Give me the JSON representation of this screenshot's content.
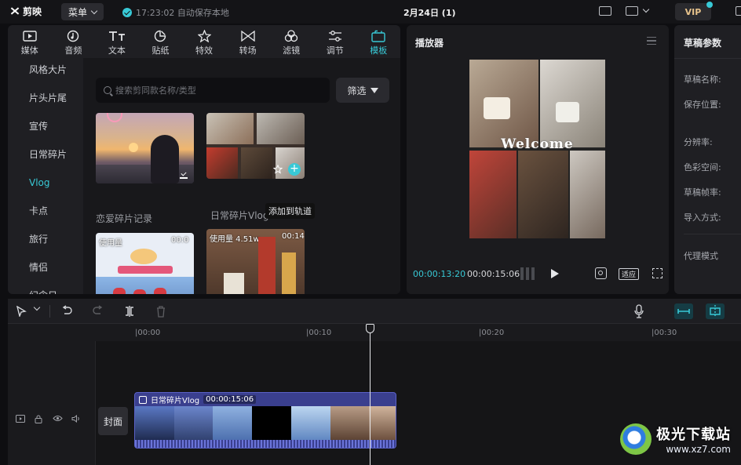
{
  "app": {
    "name": "剪映",
    "menu_label": "菜单",
    "autosave": "17:23:02 自动保存本地",
    "project_title": "2月24日 (1)",
    "vip_label": "VIP"
  },
  "tabs": [
    {
      "label": "媒体",
      "icon": "media-icon"
    },
    {
      "label": "音频",
      "icon": "audio-icon"
    },
    {
      "label": "文本",
      "icon": "text-icon"
    },
    {
      "label": "贴纸",
      "icon": "sticker-icon"
    },
    {
      "label": "特效",
      "icon": "effects-icon"
    },
    {
      "label": "转场",
      "icon": "transition-icon"
    },
    {
      "label": "滤镜",
      "icon": "filter-icon"
    },
    {
      "label": "调节",
      "icon": "adjust-icon"
    },
    {
      "label": "模板",
      "icon": "template-icon"
    }
  ],
  "active_tab": "模板",
  "sidebar": [
    "风格大片",
    "片头片尾",
    "宣传",
    "日常碎片",
    "Vlog",
    "卡点",
    "旅行",
    "情侣",
    "纪念日"
  ],
  "active_sidebar": "Vlog",
  "search": {
    "placeholder": "搜索剪同款名称/类型"
  },
  "filter_label": "筛选",
  "templates": [
    {
      "label": "恋爱碎片记录"
    },
    {
      "label": "日常碎片Vlog",
      "tooltip": "添加到轨道"
    },
    {
      "stat": "使用量",
      "duration": "00:0"
    },
    {
      "stat": "使用量 4.51w",
      "duration": "00:14"
    }
  ],
  "player": {
    "title": "播放器",
    "preview_text": "Welcome",
    "time_current": "00:00:13:20",
    "time_total": "00:00:15:06",
    "fit_label": "适应"
  },
  "params": {
    "title": "草稿参数",
    "fields": [
      "草稿名称:",
      "保存位置:",
      "分辨率:",
      "色彩空间:",
      "草稿帧率:",
      "导入方式:",
      "代理模式"
    ]
  },
  "timeline": {
    "ruler": [
      "|00:00",
      "|00:10",
      "|00:20",
      "|00:30"
    ],
    "cover_label": "封面",
    "clip_name": "日常碎片Vlog",
    "clip_duration": "00:00:15:06"
  },
  "watermark": {
    "name": "极光下载站",
    "url": "www.xz7.com"
  }
}
